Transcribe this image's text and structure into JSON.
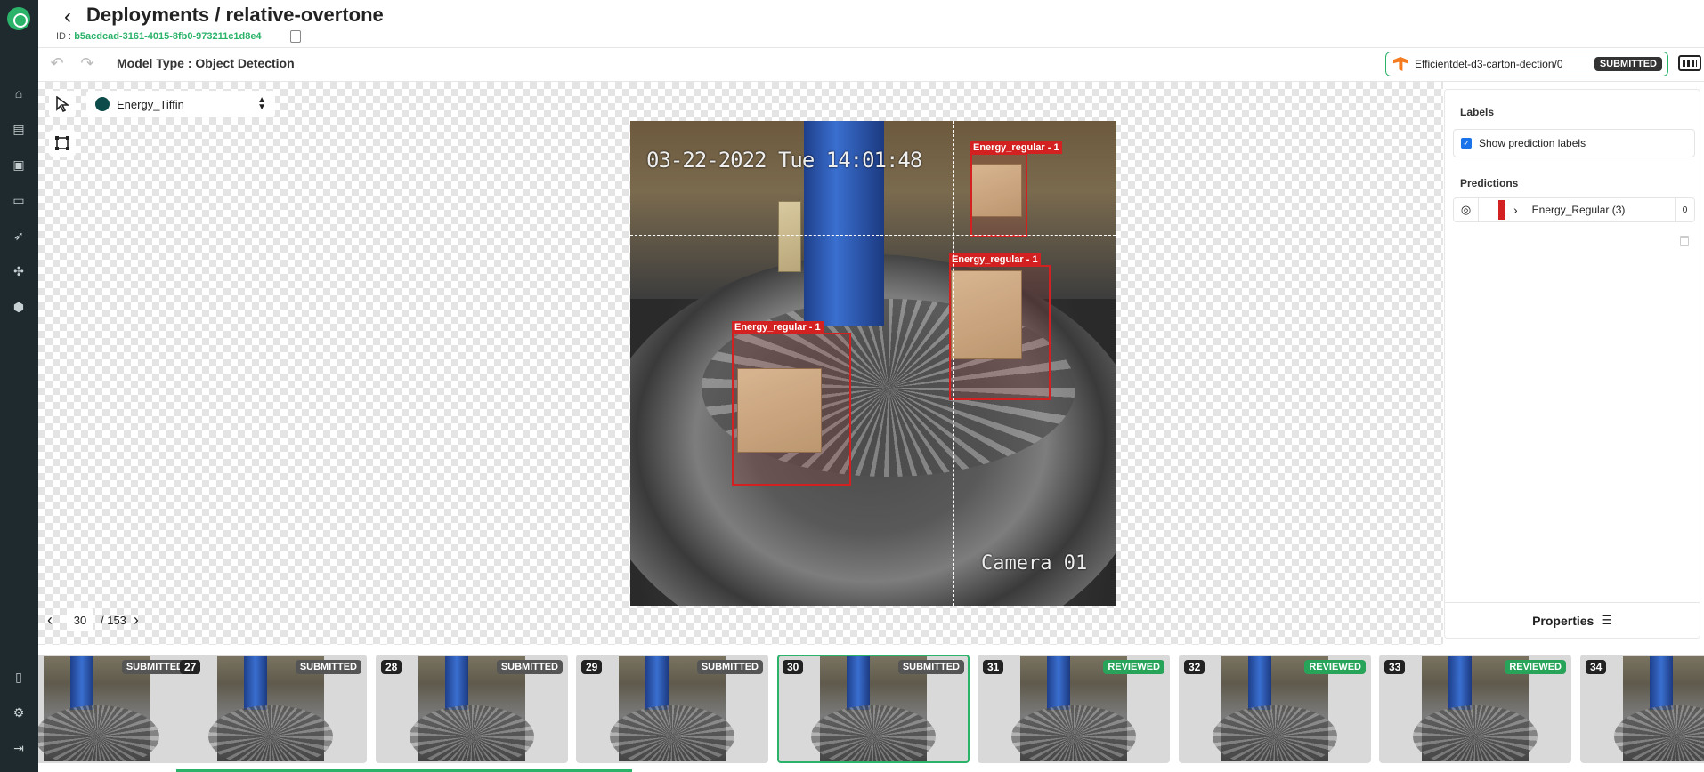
{
  "header": {
    "title": "Deployments / relative-overtone",
    "id_label": "ID :",
    "id_value": "b5acdcad-3161-4015-8fb0-973211c1d8e4"
  },
  "toolbar": {
    "model_type": "Model Type : Object Detection",
    "model_name": "Efficientdet-d3-carton-dection/0",
    "model_status": "SUBMITTED"
  },
  "canvas": {
    "selected_label": "Energy_Tiffin",
    "label_color": "#0d4a4a",
    "image_timestamp": "03-22-2022 Tue 14:01:48",
    "image_camera": "Camera 01",
    "boxes": [
      {
        "label": "Energy_regular - 1"
      },
      {
        "label": "Energy_regular - 1"
      },
      {
        "label": "Energy_regular - 1"
      }
    ]
  },
  "pager": {
    "current": "30",
    "total": "/ 153"
  },
  "panel": {
    "labels_heading": "Labels",
    "show_prediction_labels": "Show prediction labels",
    "predictions_heading": "Predictions",
    "prediction_name": "Energy_Regular (3)",
    "prediction_count": "0",
    "properties": "Properties"
  },
  "strip": {
    "items": [
      {
        "num": "",
        "status": "SUBMITTED"
      },
      {
        "num": "27",
        "status": "SUBMITTED"
      },
      {
        "num": "28",
        "status": "SUBMITTED"
      },
      {
        "num": "29",
        "status": "SUBMITTED"
      },
      {
        "num": "30",
        "status": "SUBMITTED"
      },
      {
        "num": "31",
        "status": "REVIEWED"
      },
      {
        "num": "32",
        "status": "REVIEWED"
      },
      {
        "num": "33",
        "status": "REVIEWED"
      },
      {
        "num": "34",
        "status": ""
      }
    ]
  },
  "colors": {
    "accent": "#2bb36a",
    "bbox": "#d32020",
    "reviewed": "#27a45a"
  }
}
